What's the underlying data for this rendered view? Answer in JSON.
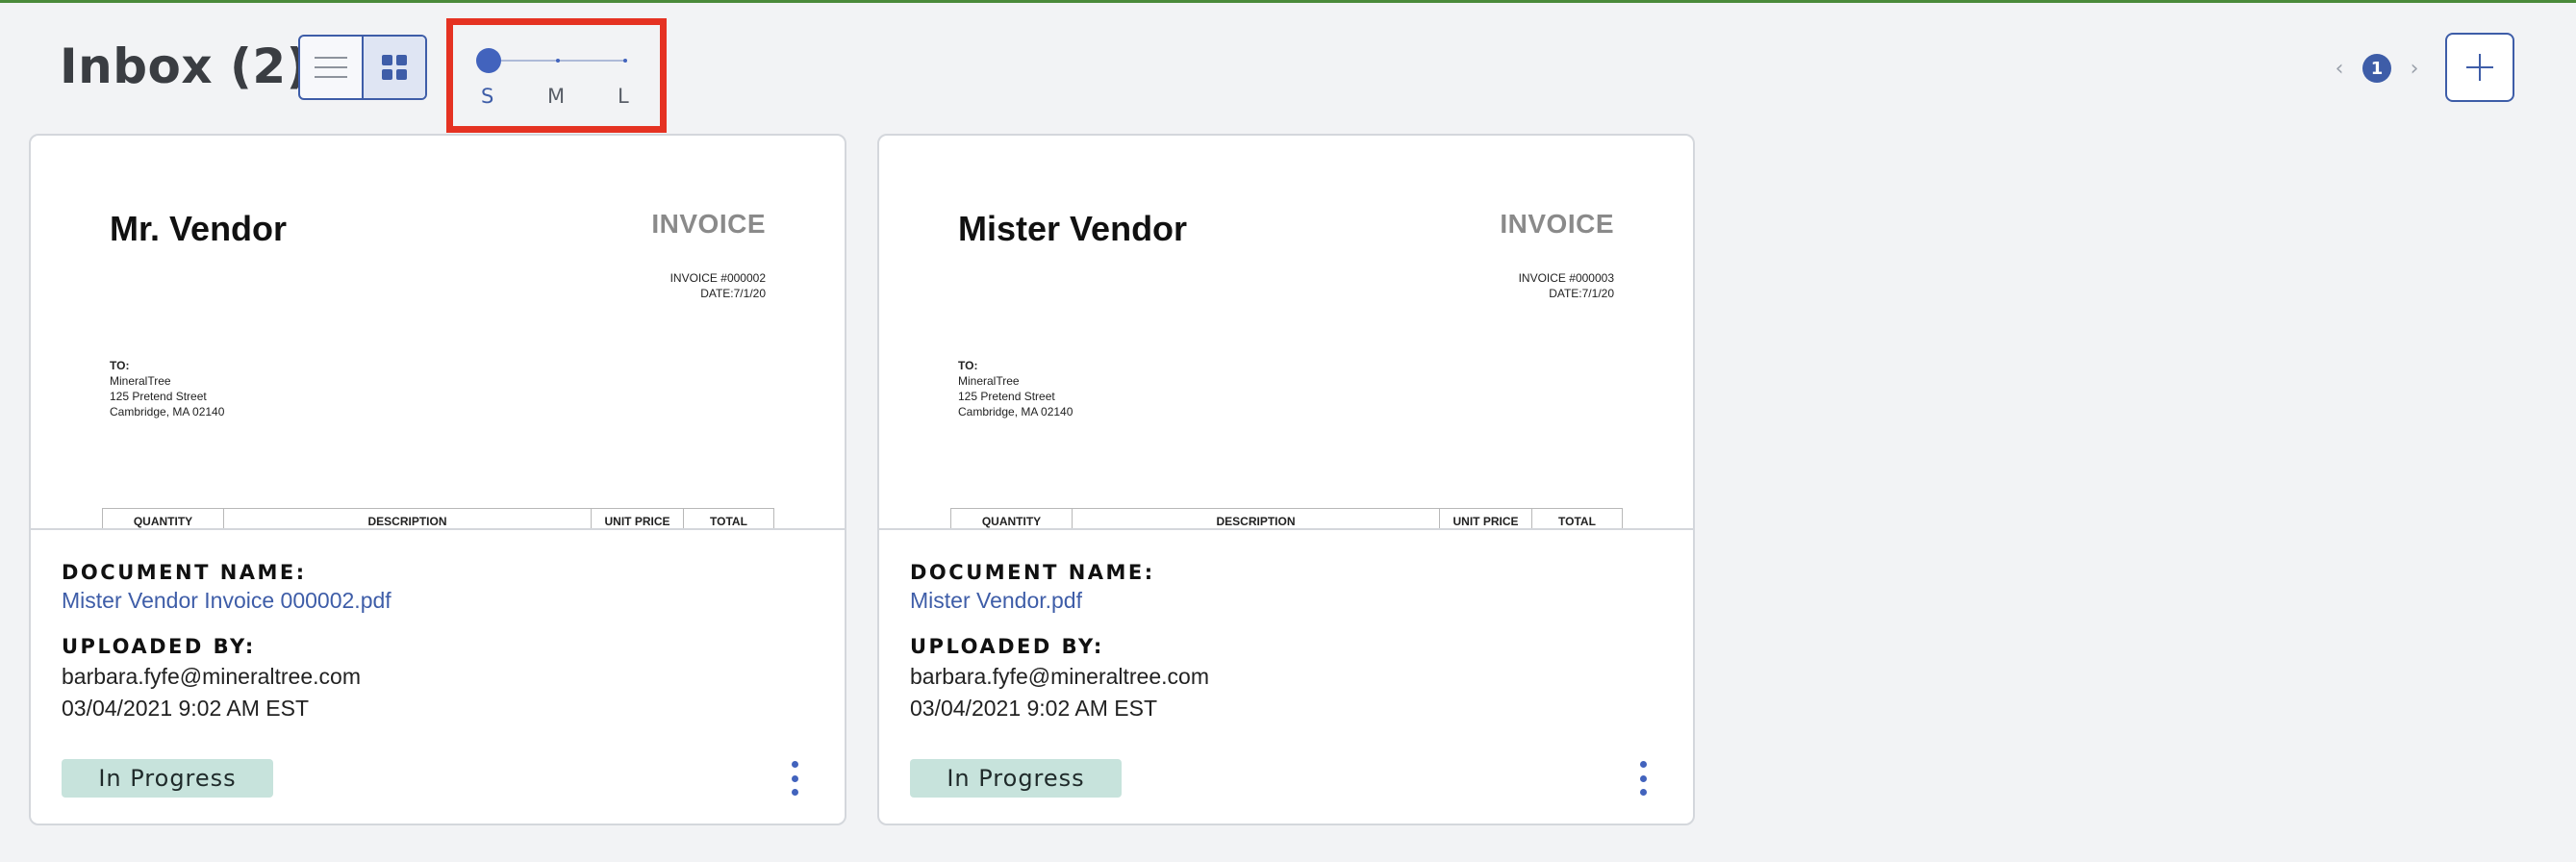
{
  "header": {
    "title": "Inbox (2)",
    "view_modes": [
      "list-view",
      "grid-view"
    ],
    "active_view": "grid-view",
    "size_slider": {
      "labels": [
        "S",
        "M",
        "L"
      ],
      "selected": "S"
    },
    "pagination": {
      "current_page": "1",
      "prev_icon": "‹",
      "next_icon": "›"
    },
    "add_button_icon": "plus-icon"
  },
  "colors": {
    "accent": "#3e5da8",
    "status_badge": "#c7e3dc",
    "highlight": "#e53222"
  },
  "documents": [
    {
      "preview": {
        "vendor": "Mr. Vendor",
        "invoice_title": "INVOICE",
        "invoice_number": "INVOICE #000002",
        "date": "DATE:7/1/20",
        "to_label": "TO:",
        "to_lines": [
          "MineralTree",
          "125 Pretend Street",
          "Cambridge, MA 02140"
        ],
        "columns": [
          "QUANTITY",
          "DESCRIPTION",
          "UNIT PRICE",
          "TOTAL"
        ]
      },
      "document_name_label": "DOCUMENT NAME:",
      "document_name": "Mister Vendor Invoice 000002.pdf",
      "uploaded_by_label": "UPLOADED BY:",
      "uploaded_by": "barbara.fyfe@mineraltree.com",
      "uploaded_at": "03/04/2021 9:02 AM EST",
      "status": "In Progress"
    },
    {
      "preview": {
        "vendor": "Mister Vendor",
        "invoice_title": "INVOICE",
        "invoice_number": "INVOICE #000003",
        "date": "DATE:7/1/20",
        "to_label": "TO:",
        "to_lines": [
          "MineralTree",
          "125 Pretend Street",
          "Cambridge, MA 02140"
        ],
        "columns": [
          "QUANTITY",
          "DESCRIPTION",
          "UNIT PRICE",
          "TOTAL"
        ]
      },
      "document_name_label": "DOCUMENT NAME:",
      "document_name": "Mister Vendor.pdf",
      "uploaded_by_label": "UPLOADED BY:",
      "uploaded_by": "barbara.fyfe@mineraltree.com",
      "uploaded_at": "03/04/2021 9:02 AM EST",
      "status": "In Progress"
    }
  ]
}
